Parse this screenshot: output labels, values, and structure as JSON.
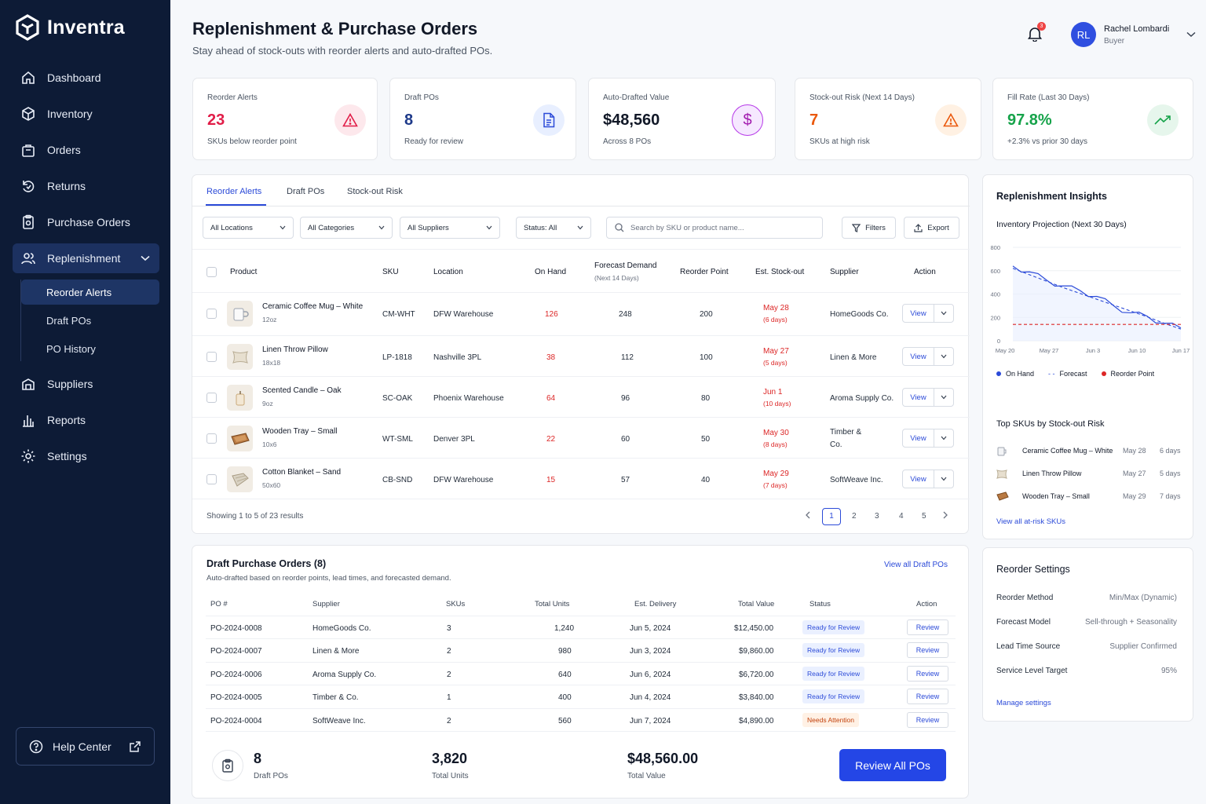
{
  "app": {
    "name": "Inventra"
  },
  "sidebar": {
    "items": [
      {
        "label": "Dashboard",
        "icon": "home-icon"
      },
      {
        "label": "Inventory",
        "icon": "box-icon"
      },
      {
        "label": "Orders",
        "icon": "bag-icon"
      },
      {
        "label": "Returns",
        "icon": "return-icon"
      },
      {
        "label": "Purchase Orders",
        "icon": "clipboard-icon"
      },
      {
        "label": "Replenishment",
        "icon": "users-icon"
      },
      {
        "label": "Suppliers",
        "icon": "supplier-icon"
      },
      {
        "label": "Reports",
        "icon": "bar-chart-icon"
      },
      {
        "label": "Settings",
        "icon": "gear-icon"
      }
    ],
    "sub_items": [
      {
        "label": "Reorder Alerts"
      },
      {
        "label": "Draft POs"
      },
      {
        "label": "PO History"
      }
    ],
    "help": "Help Center"
  },
  "header": {
    "title": "Replenishment & Purchase Orders",
    "subtitle": "Stay ahead of stock-outs with reorder alerts and auto-drafted POs.",
    "notifications": "3",
    "user": {
      "initials": "RL",
      "name": "Rachel Lombardi",
      "role": "Buyer"
    }
  },
  "kpis": [
    {
      "label": "Reorder Alerts",
      "value": "23",
      "sub": "SKUs below reorder point",
      "color": "#e11d48"
    },
    {
      "label": "Draft POs",
      "value": "8",
      "sub": "Ready for review",
      "color": "#1e3a8a"
    },
    {
      "label": "Auto-Drafted Value",
      "value": "$48,560",
      "sub": "Across 8 POs",
      "color": "#111827"
    },
    {
      "label": "Stock-out Risk (Next 14 Days)",
      "value": "7",
      "sub": "SKUs at high risk",
      "color": "#ea580c"
    },
    {
      "label": "Fill Rate (Last 30 Days)",
      "value": "97.8%",
      "sub": "+2.3% vs prior 30 days",
      "color": "#16a34a"
    }
  ],
  "tabs": [
    "Reorder Alerts",
    "Draft POs",
    "Stock-out Risk"
  ],
  "filters": {
    "locations": "All Locations",
    "categories": "All Categories",
    "suppliers": "All Suppliers",
    "status": "Status: All",
    "search_placeholder": "Search by SKU or product name...",
    "filters_btn": "Filters",
    "export_btn": "Export"
  },
  "table": {
    "headers": {
      "product": "Product",
      "sku": "SKU",
      "location": "Location",
      "on_hand": "On Hand",
      "forecast": "Forecast Demand",
      "forecast_sub": "(Next 14 Days)",
      "reorder": "Reorder Point",
      "stockout": "Est. Stock-out",
      "supplier": "Supplier",
      "action": "Action"
    },
    "rows": [
      {
        "name": "Ceramic Coffee Mug – White",
        "variant": "12oz",
        "sku": "CM-WHT",
        "location": "DFW Warehouse",
        "on_hand": "126",
        "forecast": "248",
        "reorder": "200",
        "so_date": "May 28",
        "so_days": "(6 days)",
        "supplier": "HomeGoods Co.",
        "view": "View"
      },
      {
        "name": "Linen Throw Pillow",
        "variant": "18x18",
        "sku": "LP-1818",
        "location": "Nashville 3PL",
        "on_hand": "38",
        "forecast": "112",
        "reorder": "100",
        "so_date": "May 27",
        "so_days": "(5 days)",
        "supplier": "Linen & More",
        "view": "View"
      },
      {
        "name": "Scented Candle – Oak",
        "variant": "9oz",
        "sku": "SC-OAK",
        "location": "Phoenix Warehouse",
        "on_hand": "64",
        "forecast": "96",
        "reorder": "80",
        "so_date": "Jun 1",
        "so_days": "(10 days)",
        "supplier": "Aroma Supply Co.",
        "view": "View"
      },
      {
        "name": "Wooden Tray – Small",
        "variant": "10x6",
        "sku": "WT-SML",
        "location": "Denver 3PL",
        "on_hand": "22",
        "forecast": "60",
        "reorder": "50",
        "so_date": "May 30",
        "so_days": "(8 days)",
        "supplier": "Timber &",
        "supplier2": "Co.",
        "view": "View"
      },
      {
        "name": "Cotton Blanket – Sand",
        "variant": "50x60",
        "sku": "CB-SND",
        "location": "DFW Warehouse",
        "on_hand": "15",
        "forecast": "57",
        "reorder": "40",
        "so_date": "May 29",
        "so_days": "(7 days)",
        "supplier": "SoftWeave Inc.",
        "view": "View"
      }
    ],
    "showing": "Showing 1 to 5 of 23 results",
    "pages": [
      "1",
      "2",
      "3",
      "4",
      "5"
    ]
  },
  "draft_pos": {
    "title": "Draft Purchase Orders (8)",
    "subtitle": "Auto-drafted based on reorder points, lead times, and forecasted demand.",
    "view_all": "View all Draft POs",
    "headers": {
      "po": "PO #",
      "supplier": "Supplier",
      "skus": "SKUs",
      "units": "Total Units",
      "delivery": "Est. Delivery",
      "value": "Total Value",
      "status": "Status",
      "action": "Action"
    },
    "rows": [
      {
        "po": "PO-2024-0008",
        "supplier": "HomeGoods Co.",
        "skus": "3",
        "units": "1,240",
        "delivery": "Jun 5, 2024",
        "value": "$12,450.00",
        "status": "Ready for Review",
        "warn": false,
        "action": "Review"
      },
      {
        "po": "PO-2024-0007",
        "supplier": "Linen & More",
        "skus": "2",
        "units": "980",
        "delivery": "Jun 3, 2024",
        "value": "$9,860.00",
        "status": "Ready for Review",
        "warn": false,
        "action": "Review"
      },
      {
        "po": "PO-2024-0006",
        "supplier": "Aroma Supply Co.",
        "skus": "2",
        "units": "640",
        "delivery": "Jun 6, 2024",
        "value": "$6,720.00",
        "status": "Ready for Review",
        "warn": false,
        "action": "Review"
      },
      {
        "po": "PO-2024-0005",
        "supplier": "Timber & Co.",
        "skus": "1",
        "units": "400",
        "delivery": "Jun 4, 2024",
        "value": "$3,840.00",
        "status": "Ready for Review",
        "warn": false,
        "action": "Review"
      },
      {
        "po": "PO-2024-0004",
        "supplier": "SoftWeave Inc.",
        "skus": "2",
        "units": "560",
        "delivery": "Jun 7, 2024",
        "value": "$4,890.00",
        "status": "Needs Attention",
        "warn": true,
        "action": "Review"
      }
    ],
    "summary": {
      "count": "8",
      "count_label": "Draft POs",
      "units": "3,820",
      "units_label": "Total Units",
      "value": "$48,560.00",
      "value_label": "Total Value"
    },
    "review_all": "Review All POs"
  },
  "insights": {
    "title": "Replenishment Insights",
    "chart_title": "Inventory Projection (Next 30 Days)",
    "legend": {
      "on_hand": "On Hand",
      "forecast": "Forecast",
      "reorder": "Reorder Point"
    },
    "top_title": "Top SKUs by Stock-out Risk",
    "top": [
      {
        "name": "Ceramic Coffee Mug – White",
        "date": "May 28",
        "days": "6 days"
      },
      {
        "name": "Linen Throw Pillow",
        "date": "May 27",
        "days": "5 days"
      },
      {
        "name": "Wooden Tray – Small",
        "date": "May 29",
        "days": "7 days"
      }
    ],
    "view_all": "View all at-risk SKUs"
  },
  "chart_data": {
    "type": "line",
    "title": "Inventory Projection (Next 30 Days)",
    "x": [
      "May 20",
      "May 27",
      "Jun 3",
      "Jun 10",
      "Jun 17"
    ],
    "ylim": [
      0,
      800
    ],
    "yticks": [
      0,
      200,
      400,
      600,
      800
    ],
    "series": [
      {
        "name": "On Hand",
        "style": "solid",
        "color": "#2b4ad8",
        "values": [
          640,
          590,
          520,
          470,
          430,
          380,
          300,
          240,
          210,
          150,
          110
        ]
      },
      {
        "name": "Forecast",
        "style": "dashed",
        "color": "#2b4ad8",
        "values": [
          620,
          565,
          510,
          455,
          405,
          355,
          305,
          255,
          205,
          150,
          100
        ]
      },
      {
        "name": "Reorder Point",
        "style": "dashed",
        "color": "#dc2626",
        "values": [
          140,
          140,
          140,
          140,
          140,
          140,
          140,
          140,
          140,
          140,
          140
        ]
      }
    ],
    "grid": true,
    "legend": "bottom"
  },
  "settings": {
    "title": "Reorder Settings",
    "rows": [
      {
        "k": "Reorder Method",
        "v": "Min/Max (Dynamic)"
      },
      {
        "k": "Forecast Model",
        "v": "Sell-through + Seasonality"
      },
      {
        "k": "Lead Time Source",
        "v": "Supplier Confirmed"
      },
      {
        "k": "Service Level Target",
        "v": "95%"
      }
    ],
    "manage": "Manage settings"
  }
}
